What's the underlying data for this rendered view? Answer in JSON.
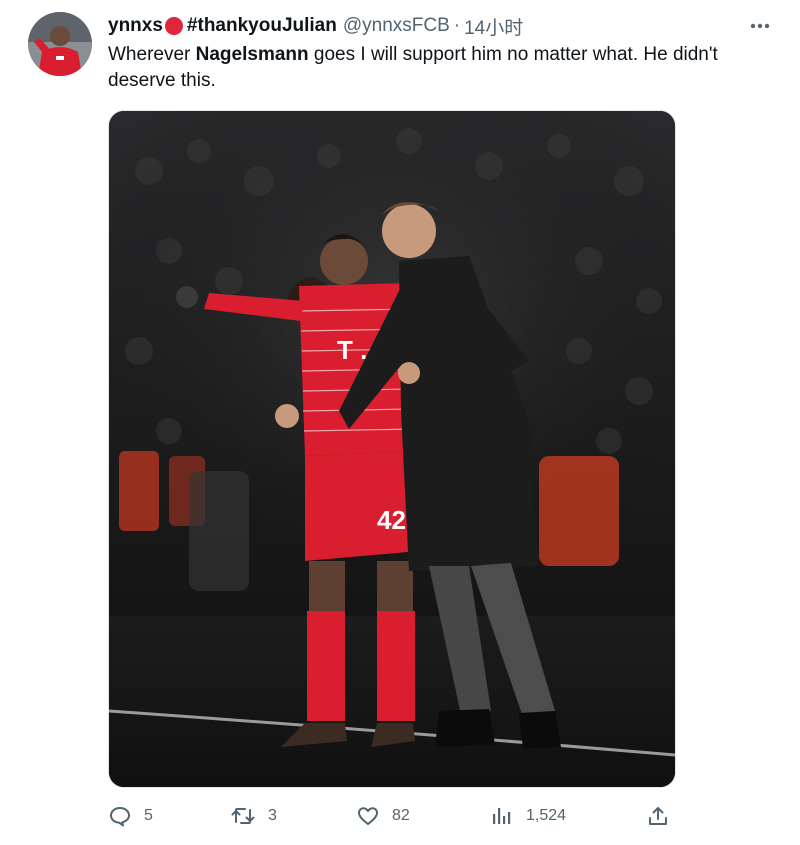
{
  "tweet": {
    "display_name": "ynnxs",
    "hashtag_name": "#thankyouJulian",
    "handle": "@ynnxsFCB",
    "separator": "·",
    "time": "14小时",
    "text_before": "Wherever ",
    "text_bold": "Nagelsmann",
    "text_after": " goes I will support him no matter what. He didn't deserve this.",
    "colors": {
      "name_dot": "#e0263b",
      "muted": "#536471",
      "text": "#0f1419",
      "kit_red": "#d81e2f"
    }
  },
  "icons": {
    "avatar": "profile-photo",
    "more": "more-dots-icon",
    "reply": "reply-bubble-icon",
    "retweet": "retweet-arrows-icon",
    "like": "heart-icon",
    "views": "bar-chart-icon",
    "share": "upload-share-icon"
  },
  "actions": {
    "reply_count": "5",
    "retweet_count": "3",
    "like_count": "82",
    "view_count": "1,524"
  },
  "media": {
    "kit_number": "42",
    "sponsor": "T . . ."
  }
}
